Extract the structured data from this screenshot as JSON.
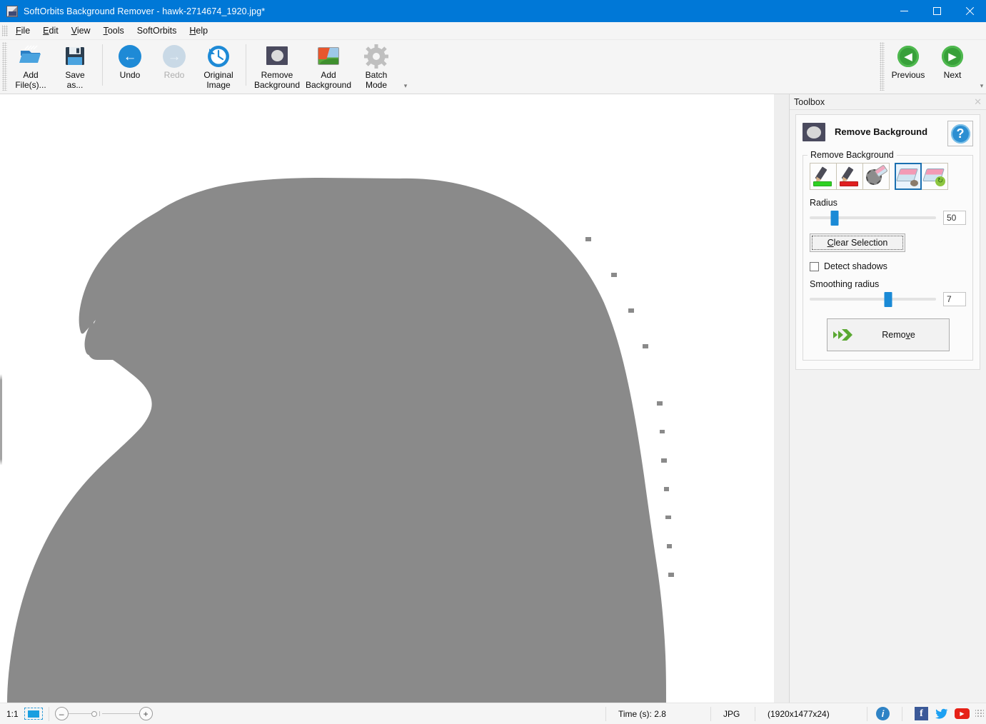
{
  "window": {
    "title": "SoftOrbits Background Remover - hawk-2714674_1920.jpg*",
    "app_icon": "app-icon",
    "minimize": "–",
    "maximize": "□",
    "close": "✕"
  },
  "menu": {
    "items": [
      {
        "mnemonic": "F",
        "rest": "ile"
      },
      {
        "mnemonic": "E",
        "rest": "dit"
      },
      {
        "mnemonic": "V",
        "rest": "iew"
      },
      {
        "mnemonic": "T",
        "rest": "ools"
      },
      {
        "mnemonic": "S",
        "rest": "oftOrbits"
      },
      {
        "mnemonic": "H",
        "rest": "elp"
      }
    ]
  },
  "toolbar": {
    "add_files": "Add\nFile(s)...",
    "save_as": "Save\nas...",
    "undo": "Undo",
    "redo": "Redo",
    "original_image": "Original\nImage",
    "remove_background": "Remove\nBackground",
    "add_background": "Add\nBackground",
    "batch_mode": "Batch\nMode",
    "previous": "Previous",
    "next": "Next",
    "overflow": "▾"
  },
  "panel": {
    "title": "Toolbox",
    "close": "✕",
    "section_title": "Remove Background",
    "group_legend": "Remove Background",
    "help_glyph": "?",
    "tools": [
      {
        "name": "mark-foreground-pencil",
        "selected": false
      },
      {
        "name": "mark-background-pencil",
        "selected": false
      },
      {
        "name": "magic-wand-eraser",
        "selected": false
      },
      {
        "name": "eraser-tool",
        "selected": true
      },
      {
        "name": "restore-eraser-tool",
        "selected": false
      }
    ],
    "radius_label": "Radius",
    "radius_value": "50",
    "radius_percent": 20,
    "clear_selection": "Clear Selection",
    "clear_selection_mnemonic": "C",
    "detect_shadows": "Detect shadows",
    "detect_shadows_checked": false,
    "smoothing_label": "Smoothing radius",
    "smoothing_value": "7",
    "smoothing_percent": 62,
    "remove_button": "Remove",
    "remove_button_mnemonic": "v"
  },
  "statusbar": {
    "zoom_ratio": "1:1",
    "fit_icon": "fit-to-window-icon",
    "zoom_out": "–",
    "zoom_in": "+",
    "time": "Time (s): 2.8",
    "format": "JPG",
    "dimensions": "(1920x1477x24)",
    "social": [
      {
        "name": "info-icon",
        "glyph": "i"
      },
      {
        "name": "facebook-icon",
        "glyph": "f"
      },
      {
        "name": "twitter-icon",
        "glyph": "🐦"
      },
      {
        "name": "youtube-icon",
        "glyph": "▶"
      }
    ]
  },
  "canvas": {
    "image_name": "hawk-silhouette",
    "background_color": "#ffffff",
    "subject_color": "#8a8a8a"
  },
  "colors": {
    "titlebar": "#0078d7",
    "accent": "#1a8ad6",
    "panel_bg": "#f2f2f2",
    "green": "#38a03a"
  }
}
